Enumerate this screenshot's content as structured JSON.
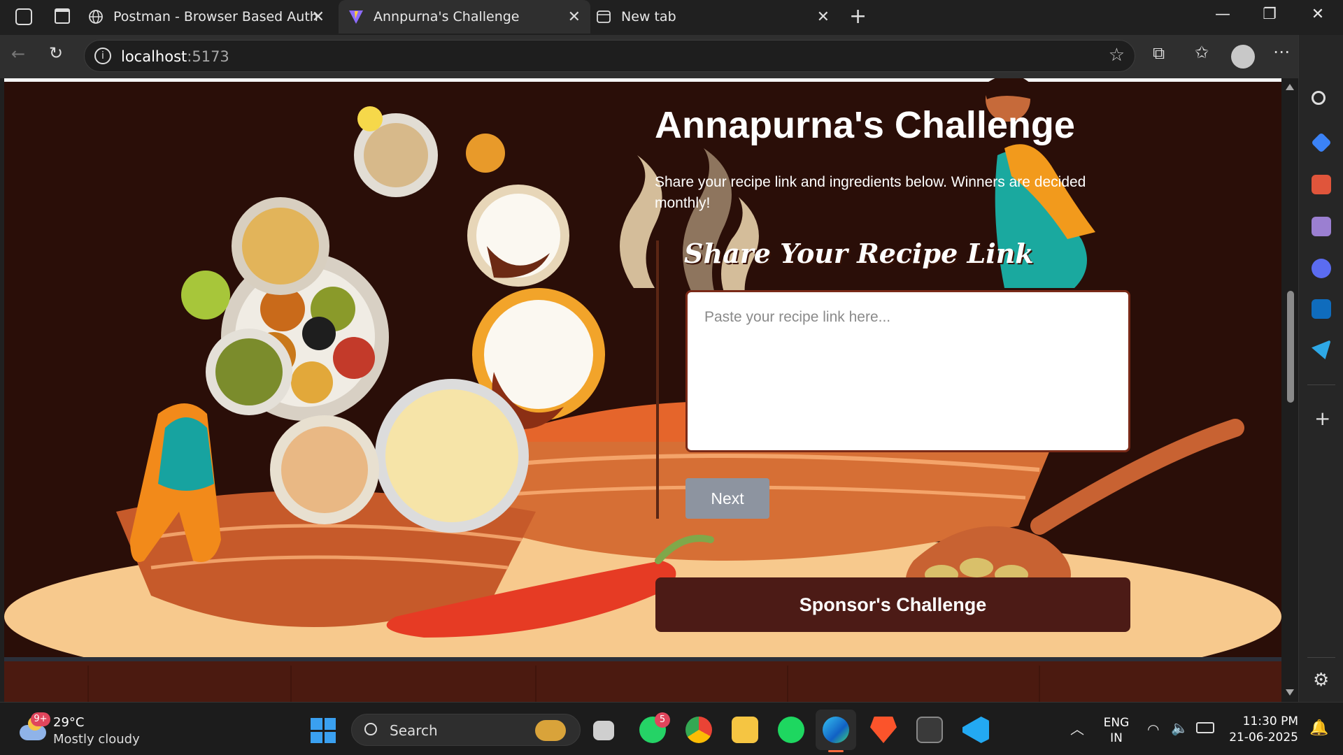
{
  "browser": {
    "tabs": [
      {
        "label": "Postman - Browser Based Auth",
        "icon": "globe-icon",
        "active": false
      },
      {
        "label": "Annpurna's Challenge",
        "icon": "vite-logo-icon",
        "active": true
      },
      {
        "label": "New tab",
        "icon": "new-tab-icon",
        "active": false
      }
    ],
    "url_host": "localhost",
    "url_port": ":5173"
  },
  "page": {
    "title": "Annapurna's Challenge",
    "subtitle": "Share your recipe link and ingredients below. Winners are decided monthly!",
    "recipe_link_heading": "Share Your Recipe Link",
    "link_placeholder": "Paste your recipe link here...",
    "next_label": "Next",
    "sponsor_label": "Sponsor's Challenge"
  },
  "taskbar": {
    "weather_badge": "9+",
    "temperature": "29°C",
    "weather": "Mostly cloudy",
    "search_label": "Search",
    "whatsapp_badge": "5",
    "lang_top": "ENG",
    "lang_bottom": "IN",
    "time": "11:30 PM",
    "date": "21-06-2025"
  },
  "colors": {
    "page_bg": "#2a0e08",
    "sponsor_button": "#4c1b16",
    "next_button": "#8d94a0",
    "plate": "#f5c98a",
    "bowl": "#d9793e"
  }
}
